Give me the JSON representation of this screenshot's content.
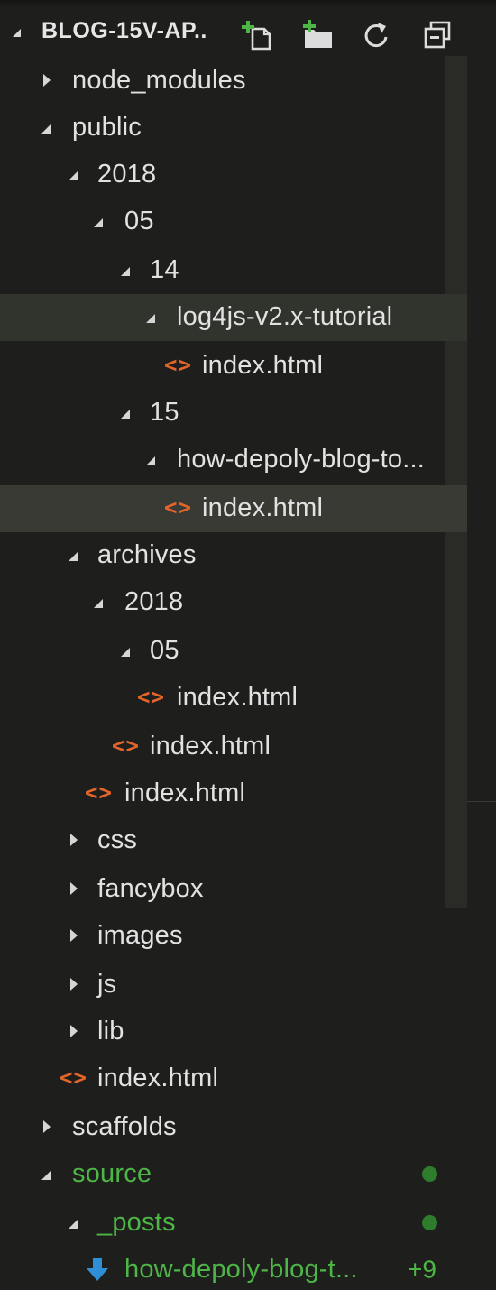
{
  "explorer": {
    "title": "BLOG-15V-AP..",
    "actions": {
      "new_file": "new-file-icon",
      "new_folder": "new-folder-icon",
      "refresh": "refresh-icon",
      "collapse_all": "collapse-all-icon"
    }
  },
  "tree": [
    {
      "label": "node_modules",
      "kind": "folder",
      "state": "collapsed"
    },
    {
      "label": "public",
      "kind": "folder",
      "state": "expanded"
    },
    {
      "label": "2018",
      "kind": "folder",
      "state": "expanded"
    },
    {
      "label": "05",
      "kind": "folder",
      "state": "expanded"
    },
    {
      "label": "14",
      "kind": "folder",
      "state": "expanded"
    },
    {
      "label": "log4js-v2.x-tutorial",
      "kind": "folder",
      "state": "expanded"
    },
    {
      "label": "index.html",
      "kind": "file",
      "icon": "<>"
    },
    {
      "label": "15",
      "kind": "folder",
      "state": "expanded"
    },
    {
      "label": "how-depoly-blog-to...",
      "kind": "folder",
      "state": "expanded"
    },
    {
      "label": "index.html",
      "kind": "file",
      "icon": "<>"
    },
    {
      "label": "archives",
      "kind": "folder",
      "state": "expanded"
    },
    {
      "label": "2018",
      "kind": "folder",
      "state": "expanded"
    },
    {
      "label": "05",
      "kind": "folder",
      "state": "expanded"
    },
    {
      "label": "index.html",
      "kind": "file",
      "icon": "<>"
    },
    {
      "label": "index.html",
      "kind": "file",
      "icon": "<>"
    },
    {
      "label": "index.html",
      "kind": "file",
      "icon": "<>"
    },
    {
      "label": "css",
      "kind": "folder",
      "state": "collapsed"
    },
    {
      "label": "fancybox",
      "kind": "folder",
      "state": "collapsed"
    },
    {
      "label": "images",
      "kind": "folder",
      "state": "collapsed"
    },
    {
      "label": "js",
      "kind": "folder",
      "state": "collapsed"
    },
    {
      "label": "lib",
      "kind": "folder",
      "state": "collapsed"
    },
    {
      "label": "index.html",
      "kind": "file",
      "icon": "<>"
    },
    {
      "label": "scaffolds",
      "kind": "folder",
      "state": "collapsed"
    },
    {
      "label": "source",
      "kind": "folder",
      "state": "expanded",
      "git": "modified"
    },
    {
      "label": "_posts",
      "kind": "folder",
      "state": "expanded",
      "git": "modified"
    },
    {
      "label": "how-depoly-blog-t...",
      "kind": "file",
      "icon": "download-icon",
      "git": "added",
      "badge": "+9"
    }
  ],
  "colors": {
    "background": "#1e1f1c",
    "text": "#e2e2e2",
    "file_icon": "#e4652a",
    "git_green": "#4db646",
    "download_blue": "#2f8fd6"
  }
}
